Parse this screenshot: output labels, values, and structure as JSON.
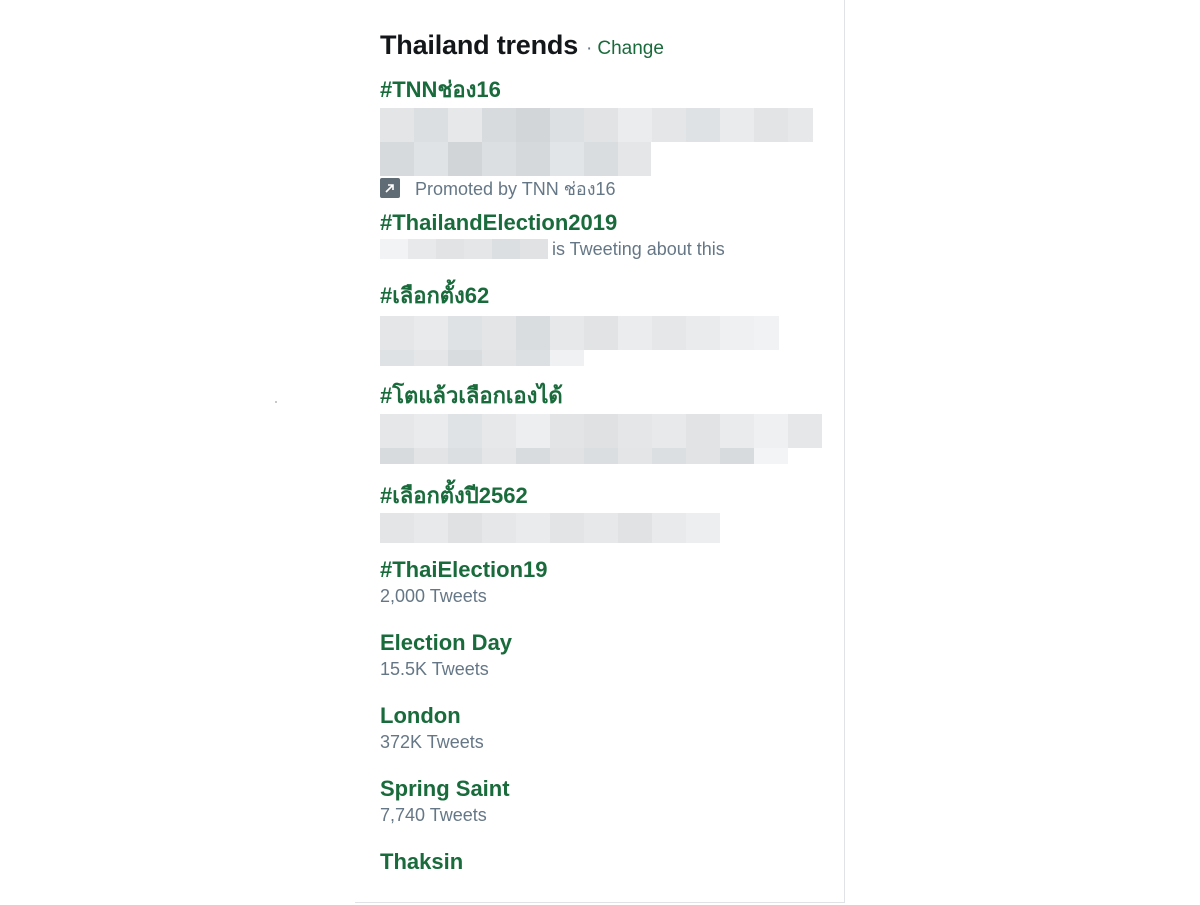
{
  "header": {
    "title": "Thailand trends",
    "separator": "·",
    "change_label": "Change"
  },
  "trends": [
    {
      "name": "#TNNช่อง16",
      "promoted_text": "Promoted by TNN ช่อง16",
      "promoted_icon": "promoted-arrow-icon"
    },
    {
      "name": "#ThailandElection2019",
      "meta": "is Tweeting about this"
    },
    {
      "name": "#เลือกตั้ง62"
    },
    {
      "name": "#โตแล้วเลือกเองได้"
    },
    {
      "name": "#เลือกตั้งปี2562"
    },
    {
      "name": "#ThaiElection19",
      "meta": "2,000 Tweets"
    },
    {
      "name": "Election Day",
      "meta": "15.5K Tweets"
    },
    {
      "name": "London",
      "meta": "372K Tweets"
    },
    {
      "name": "Spring Saint",
      "meta": "7,740 Tweets"
    },
    {
      "name": "Thaksin"
    }
  ],
  "colors": {
    "trend_link": "#1a6b3c",
    "meta_text": "#657786",
    "title_text": "#14171a",
    "blur_light": "#eceeef",
    "blur_dark": "#d9dcde"
  }
}
